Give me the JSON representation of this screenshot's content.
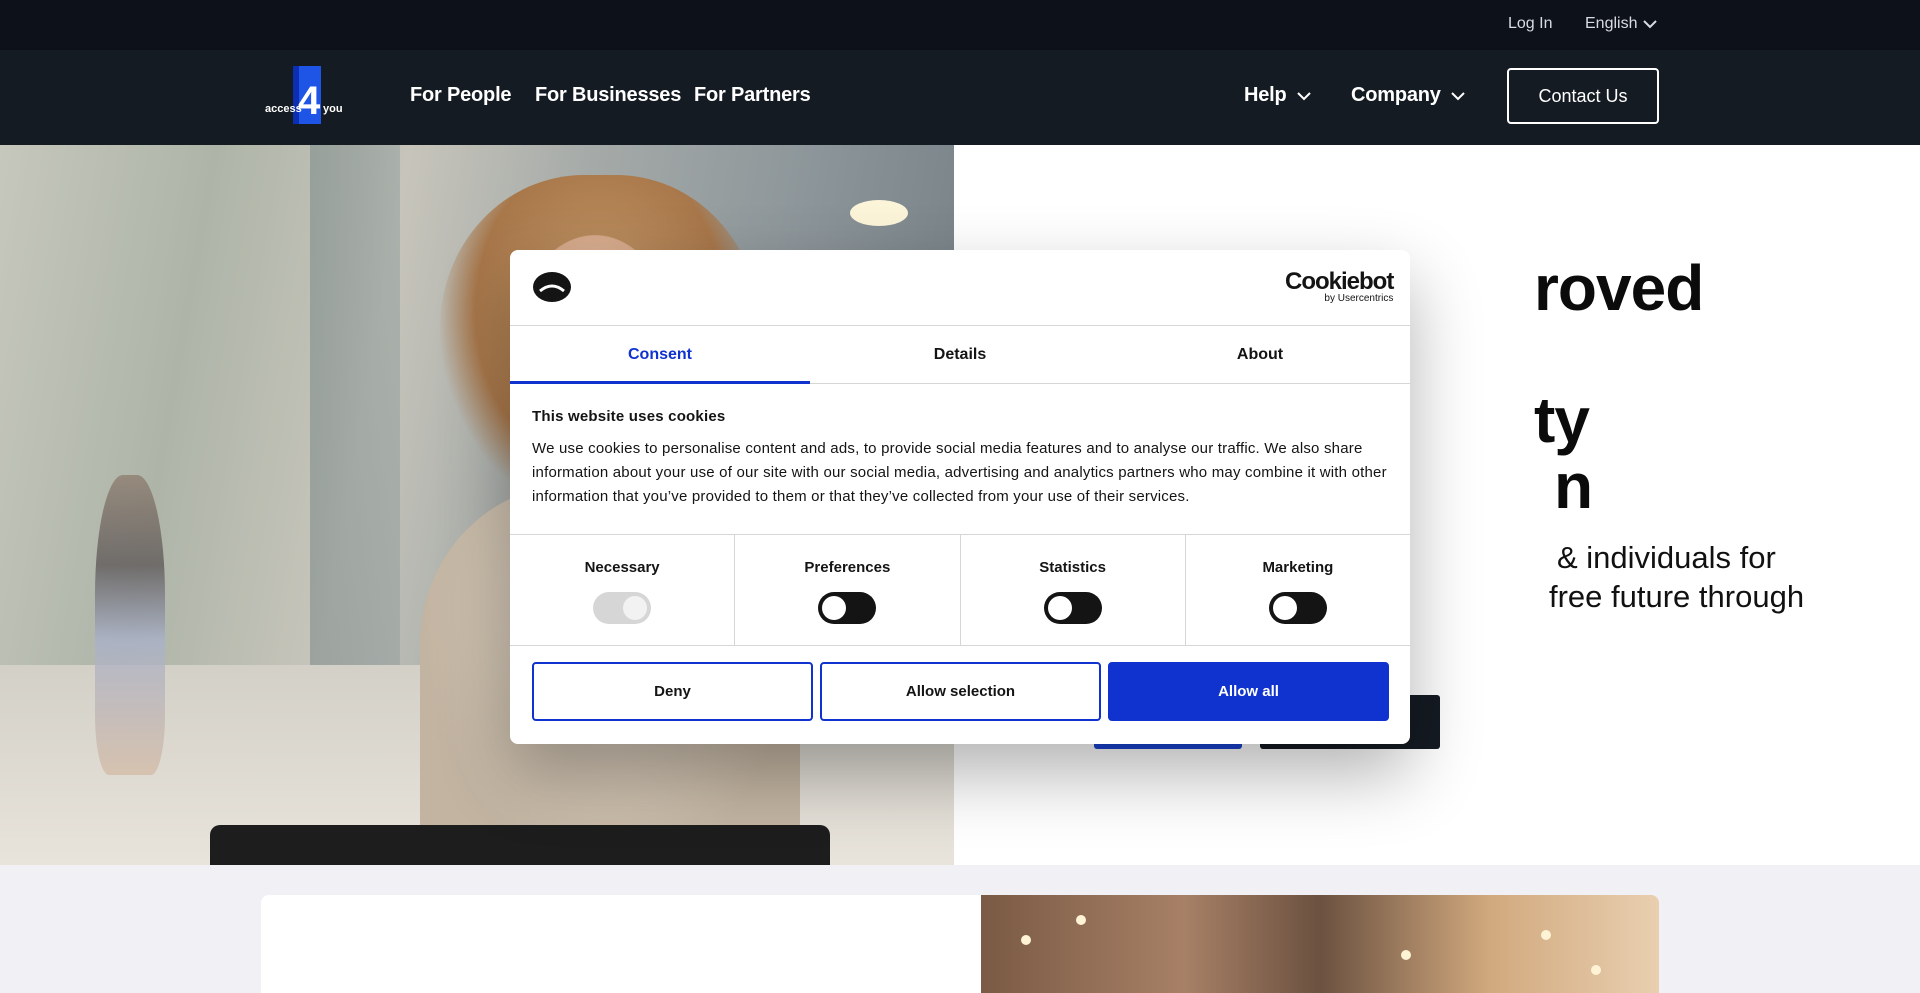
{
  "topbar": {
    "login": "Log In",
    "language": "English"
  },
  "logo": {
    "text_left": "access",
    "numeral": "4",
    "text_right": "you"
  },
  "nav": {
    "links": [
      "For People",
      "For Businesses",
      "For Partners"
    ],
    "help": "Help",
    "company": "Company",
    "contact": "Contact Us"
  },
  "hero": {
    "title_lines": [
      "roved",
      "ty",
      "n"
    ],
    "subtitle_lines": [
      "& individuals for",
      "free future through"
    ]
  },
  "cookie": {
    "brand": "Cookiebot",
    "brand_sub": "by Usercentrics",
    "tabs": [
      "Consent",
      "Details",
      "About"
    ],
    "active_tab": "Consent",
    "heading": "This website uses cookies",
    "body": "We use cookies to personalise content and ads, to provide social media features and to analyse our traffic. We also share information about your use of our site with our social media, advertising and analytics partners who may combine it with other information that you’ve provided to them or that they’ve collected from your use of their services.",
    "categories": [
      {
        "label": "Necessary",
        "state": "on",
        "disabled": true
      },
      {
        "label": "Preferences",
        "state": "off",
        "disabled": false
      },
      {
        "label": "Statistics",
        "state": "off",
        "disabled": false
      },
      {
        "label": "Marketing",
        "state": "off",
        "disabled": false
      }
    ],
    "buttons": {
      "deny": "Deny",
      "selection": "Allow selection",
      "all": "Allow all"
    }
  },
  "colors": {
    "accent": "#1032cf",
    "nav_bg": "#151b23",
    "topbar_bg": "#0c111a"
  }
}
